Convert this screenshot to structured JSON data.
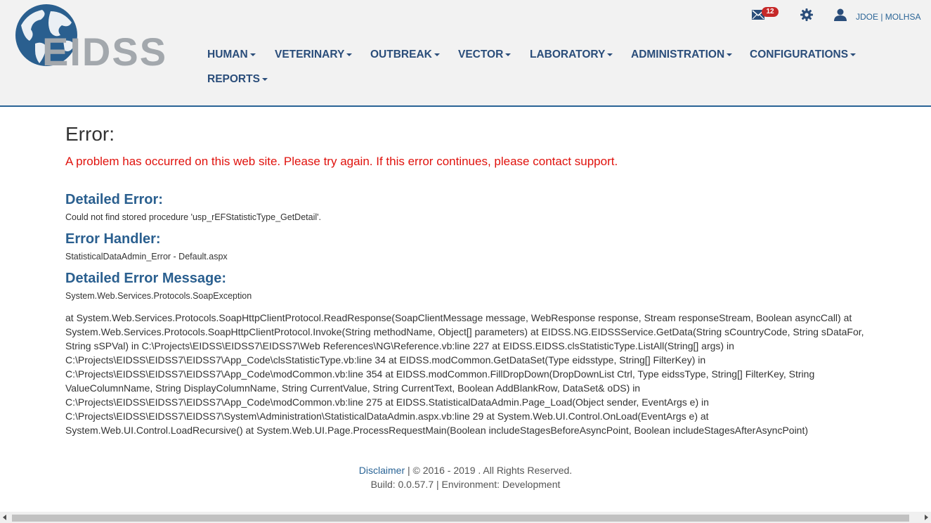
{
  "header": {
    "logo_text": "EIDSS",
    "nav": [
      {
        "label": "HUMAN"
      },
      {
        "label": "VETERINARY"
      },
      {
        "label": "OUTBREAK"
      },
      {
        "label": "VECTOR"
      },
      {
        "label": "LABORATORY"
      },
      {
        "label": "ADMINISTRATION"
      },
      {
        "label": "CONFIGURATIONS"
      },
      {
        "label": "REPORTS"
      }
    ],
    "mail_count": "12",
    "user_label": "JDOE | MOLHSA",
    "icons": {
      "mail": "mail-icon",
      "settings": "gear-icon",
      "user": "user-icon"
    }
  },
  "error": {
    "title": "Error:",
    "message": "A problem has occurred on this web site. Please try again. If this error continues, please contact support.",
    "detailed_error_heading": "Detailed Error:",
    "detailed_error_text": "Could not find stored procedure 'usp_rEFStatisticType_GetDetail'.",
    "handler_heading": "Error Handler:",
    "handler_text": "StatisticalDataAdmin_Error - Default.aspx",
    "detailed_message_heading": "Detailed Error Message:",
    "detailed_message_text": "System.Web.Services.Protocols.SoapException",
    "stack_trace": [
      "at System.Web.Services.Protocols.SoapHttpClientProtocol.ReadResponse(SoapClientMessage message, WebResponse response, Stream responseStream, Boolean asyncCall) at",
      "System.Web.Services.Protocols.SoapHttpClientProtocol.Invoke(String methodName, Object[] parameters) at EIDSS.NG.EIDSSService.GetData(String sCountryCode, String sDataFor,",
      "String sSPVal) in C:\\Projects\\EIDSS\\EIDSS7\\EIDSS7\\Web References\\NG\\Reference.vb:line 227 at EIDSS.EIDSS.clsStatisticType.ListAll(String[] args) in",
      "C:\\Projects\\EIDSS\\EIDSS7\\EIDSS7\\App_Code\\clsStatisticType.vb:line 34 at EIDSS.modCommon.GetDataSet(Type eidsstype, String[] FilterKey) in",
      "C:\\Projects\\EIDSS\\EIDSS7\\EIDSS7\\App_Code\\modCommon.vb:line 354 at EIDSS.modCommon.FillDropDown(DropDownList Ctrl, Type eidssType, String[] FilterKey, String",
      "ValueColumnName, String DisplayColumnName, String CurrentValue, String CurrentText, Boolean AddBlankRow, DataSet& oDS) in",
      "C:\\Projects\\EIDSS\\EIDSS7\\EIDSS7\\App_Code\\modCommon.vb:line 275 at EIDSS.StatisticalDataAdmin.Page_Load(Object sender, EventArgs e) in",
      "C:\\Projects\\EIDSS\\EIDSS7\\EIDSS7\\System\\Administration\\StatisticalDataAdmin.aspx.vb:line 29 at System.Web.UI.Control.OnLoad(EventArgs e) at",
      "System.Web.UI.Control.LoadRecursive() at System.Web.UI.Page.ProcessRequestMain(Boolean includeStagesBeforeAsyncPoint, Boolean includeStagesAfterAsyncPoint)"
    ]
  },
  "footer": {
    "disclaimer_link": "Disclaimer",
    "copyright": " | © 2016 - 2019 . All Rights Reserved.",
    "build": "Build: 0.0.57.7 | Environment: Development"
  },
  "colors": {
    "nav_text": "#2a4d7a",
    "heading": "#2a5f8f",
    "error_text": "#e0120d",
    "header_bg": "#f2f2f2",
    "badge": "#c62828"
  }
}
